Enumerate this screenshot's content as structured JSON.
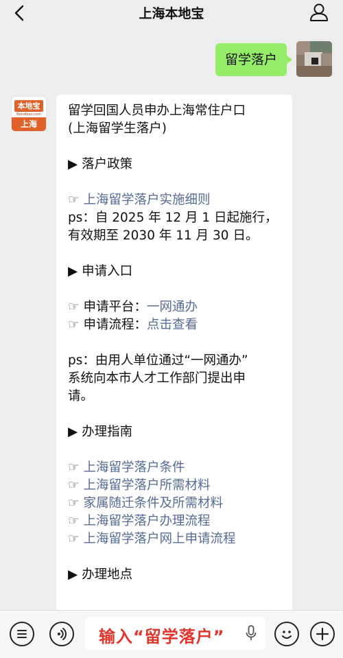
{
  "header": {
    "title": "上海本地宝",
    "back_icon": "chevron-left-icon",
    "profile_icon": "person-icon"
  },
  "sent_message": {
    "text": "留学落户"
  },
  "bot": {
    "avatar_brand": "本地宝",
    "avatar_url": "Bendibao.com",
    "avatar_city": "上海"
  },
  "reply": {
    "title_line1": "留学回国人员申办上海常住户口",
    "title_line2": "(上海留学生落户)",
    "section1": "▶ 落户政策",
    "hand": "☞",
    "policy_link": "上海留学落户实施细则",
    "policy_note_line1": "ps：自 2025 年 12 月 1 日起施行，",
    "policy_note_line2": "有效期至 2030 年 11 月 30 日。",
    "section2": "▶ 申请入口",
    "platform_label": "申请平台：",
    "platform_link": "一网通办",
    "process_label": "申请流程：",
    "process_link": "点击查看",
    "entry_note_line1": "ps：由用人单位通过“一网通办”",
    "entry_note_line2": "系统向本市人才工作部门提出申",
    "entry_note_line3": "请。",
    "section3": "▶ 办理指南",
    "guide_links": [
      "上海留学落户条件",
      "上海留学落户所需材料",
      "家属随迁条件及所需材料",
      "上海留学落户办理流程",
      "上海留学落户网上申请流程"
    ],
    "section4": "▶ 办理地点"
  },
  "bottom": {
    "input_text": "输入“留学落户”",
    "accent_color": "#e0352b",
    "icons": [
      "menu-icon",
      "voice-icon",
      "mic-icon",
      "emoji-icon",
      "plus-icon"
    ]
  }
}
